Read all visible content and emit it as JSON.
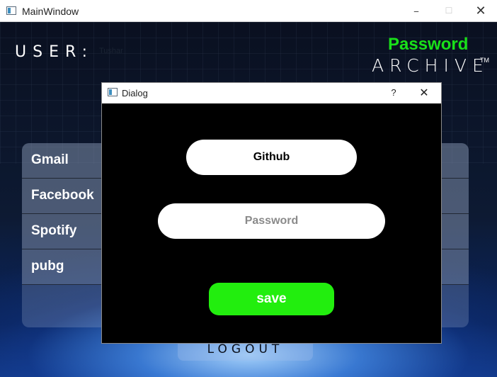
{
  "window": {
    "title": "MainWindow",
    "controls": {
      "minimize": "–",
      "maximize": "☐",
      "close": "✕"
    }
  },
  "header": {
    "user_label": "USER:",
    "user_name": "Tushar",
    "logo_line1": "Password",
    "logo_line2": "ARCHIVE",
    "logo_tm": "TM",
    "logo_color": "#19e019"
  },
  "accounts": {
    "items": [
      {
        "label": "Gmail"
      },
      {
        "label": "Facebook"
      },
      {
        "label": "Spotify"
      },
      {
        "label": "pubg"
      }
    ]
  },
  "logout_label": "LOGOUT",
  "dialog": {
    "title": "Dialog",
    "help": "?",
    "close": "✕",
    "site_value": "Github",
    "password_placeholder": "Password",
    "password_value": "",
    "save_label": "save",
    "save_color": "#22ee0e"
  }
}
